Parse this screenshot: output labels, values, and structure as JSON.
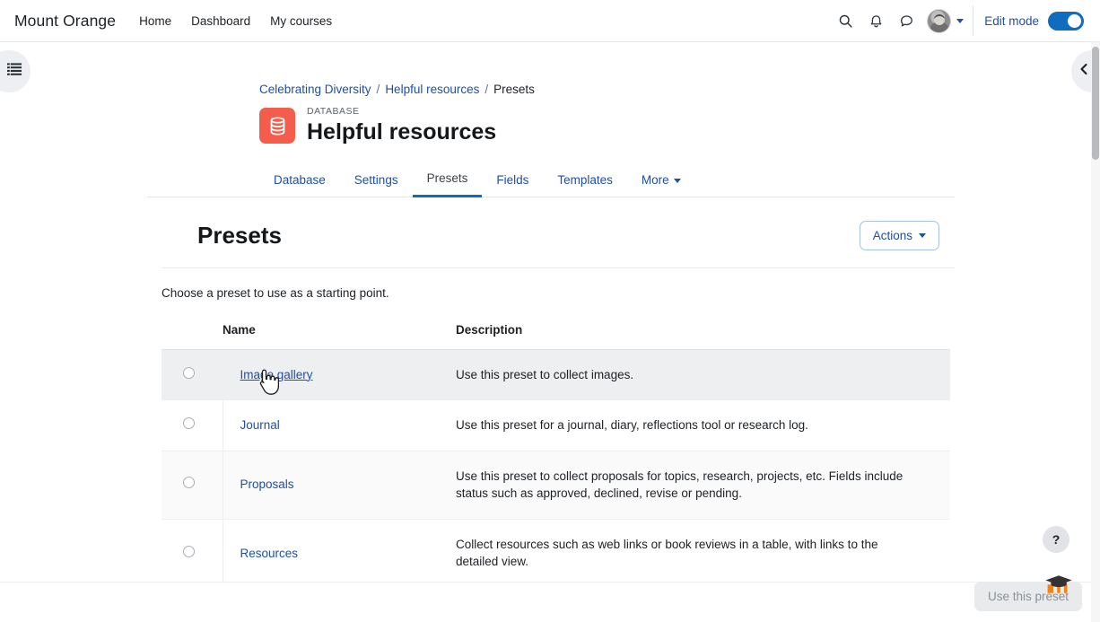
{
  "navbar": {
    "brand": "Mount Orange",
    "links": [
      {
        "label": "Home"
      },
      {
        "label": "Dashboard"
      },
      {
        "label": "My courses"
      }
    ],
    "icons": {
      "search": "search-icon",
      "notifications": "bell-icon",
      "messages": "message-icon"
    },
    "edit_mode_label": "Edit mode",
    "edit_mode_on": true
  },
  "breadcrumb": {
    "items": [
      {
        "label": "Celebrating Diversity",
        "link": true
      },
      {
        "label": "Helpful resources",
        "link": true
      },
      {
        "label": "Presets",
        "link": false
      }
    ],
    "separator": "/"
  },
  "activity": {
    "type_label": "DATABASE",
    "title": "Helpful resources",
    "icon": "database-icon",
    "icon_color": "#f45c4c"
  },
  "tabs": [
    {
      "label": "Database",
      "active": false,
      "caret": false
    },
    {
      "label": "Settings",
      "active": false,
      "caret": false
    },
    {
      "label": "Presets",
      "active": true,
      "caret": false
    },
    {
      "label": "Fields",
      "active": false,
      "caret": false
    },
    {
      "label": "Templates",
      "active": false,
      "caret": false
    },
    {
      "label": "More",
      "active": false,
      "caret": true
    }
  ],
  "presets": {
    "heading": "Presets",
    "actions_button": "Actions",
    "intro": "Choose a preset to use as a starting point.",
    "columns": {
      "radio": "",
      "name": "Name",
      "description": "Description"
    },
    "rows": [
      {
        "name": "Image gallery",
        "description": "Use this preset to collect images.",
        "selected": false,
        "hovered": true
      },
      {
        "name": "Journal",
        "description": "Use this preset for a journal, diary, reflections tool or research log.",
        "selected": false,
        "hovered": false
      },
      {
        "name": "Proposals",
        "description": "Use this preset to collect proposals for topics, research, projects, etc. Fields include status such as approved, declined, revise or pending.",
        "selected": false,
        "hovered": false
      },
      {
        "name": "Resources",
        "description": "Collect resources such as web links or book reviews in a table, with links to the detailed view.",
        "selected": false,
        "hovered": false
      }
    ]
  },
  "footer": {
    "use_preset_button": "Use this preset",
    "use_preset_disabled": true,
    "logo": "moodle-logo"
  },
  "help": {
    "label": "?"
  },
  "drawers": {
    "left_toggle_icon": "list-icon",
    "right_toggle_icon": "chevron-left-icon"
  },
  "colors": {
    "accent": "#0f6cbf",
    "link": "#1f4fa3",
    "activity_icon": "#f45c4c",
    "row_hover": "#eeeff1",
    "row_stripe": "#fafafb"
  }
}
